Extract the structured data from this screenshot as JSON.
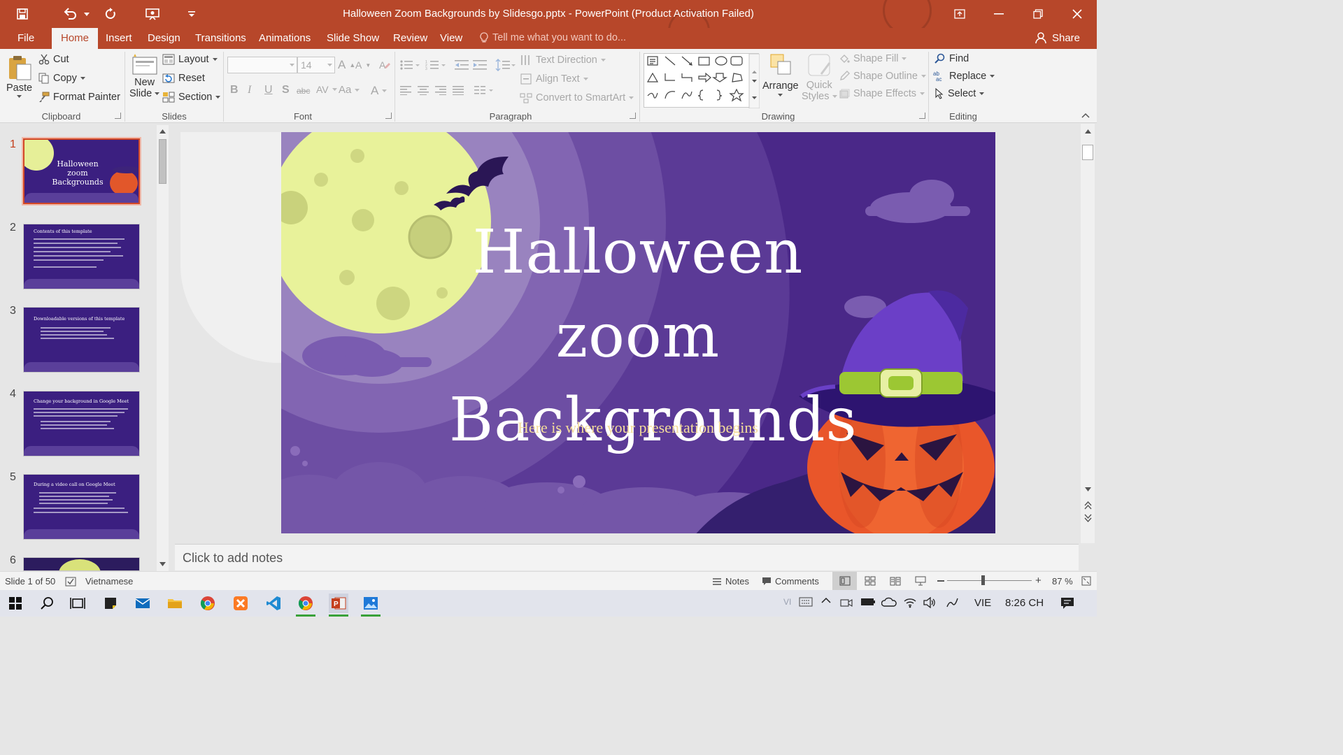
{
  "window": {
    "title": "Halloween Zoom Backgrounds by Slidesgo.pptx - PowerPoint (Product Activation Failed)"
  },
  "ribbon_tabs": [
    "File",
    "Home",
    "Insert",
    "Design",
    "Transitions",
    "Animations",
    "Slide Show",
    "Review",
    "View"
  ],
  "active_tab": "Home",
  "tell_me_placeholder": "Tell me what you want to do...",
  "share_label": "Share",
  "clipboard": {
    "paste": "Paste",
    "cut": "Cut",
    "copy": "Copy",
    "format_painter": "Format Painter",
    "group": "Clipboard"
  },
  "slides_group": {
    "new_slide_1": "New",
    "new_slide_2": "Slide",
    "layout": "Layout",
    "reset": "Reset",
    "section": "Section",
    "group": "Slides"
  },
  "font_group": {
    "font_name": "",
    "font_size": "14",
    "bold": "B",
    "italic": "I",
    "underline": "U",
    "shadow": "S",
    "strike": "abc",
    "spacing": "AV",
    "case": "Aa",
    "color": "A",
    "group": "Font"
  },
  "paragraph_group": {
    "text_direction": "Text Direction",
    "align_text": "Align Text",
    "convert_smartart": "Convert to SmartArt",
    "group": "Paragraph"
  },
  "drawing_group": {
    "arrange": "Arrange",
    "quick_1": "Quick",
    "quick_2": "Styles",
    "shape_fill": "Shape Fill",
    "shape_outline": "Shape Outline",
    "shape_effects": "Shape Effects",
    "group": "Drawing"
  },
  "editing_group": {
    "find": "Find",
    "replace": "Replace",
    "select": "Select",
    "group": "Editing"
  },
  "thumbnails": [
    {
      "num": "1",
      "title": "Halloween zoom Backgrounds",
      "selected": true
    },
    {
      "num": "2",
      "title": "Contents of this template",
      "selected": false
    },
    {
      "num": "3",
      "title": "Downloadable versions of this template",
      "selected": false
    },
    {
      "num": "4",
      "title": "Change your background in Google Meet",
      "selected": false
    },
    {
      "num": "5",
      "title": "During a video call on Google Meet",
      "selected": false
    },
    {
      "num": "6",
      "title": "",
      "selected": false
    }
  ],
  "slide": {
    "title_line1": "Halloween zoom",
    "title_line2": "Backgrounds",
    "subtitle": "Here is where your presentation begins"
  },
  "notes_placeholder": "Click to add notes",
  "status": {
    "slide_info": "Slide 1 of 50",
    "language": "Vietnamese",
    "notes": "Notes",
    "comments": "Comments",
    "zoom": "87 %"
  },
  "taskbar": {
    "lang": "VIE",
    "time": "8:26 CH",
    "vi_indicator": "VI"
  },
  "colors": {
    "accent": "#b7472a",
    "slide_bg": "#5d3a98",
    "moon": "#e9f39c",
    "subtitle": "#f4dc9a"
  }
}
